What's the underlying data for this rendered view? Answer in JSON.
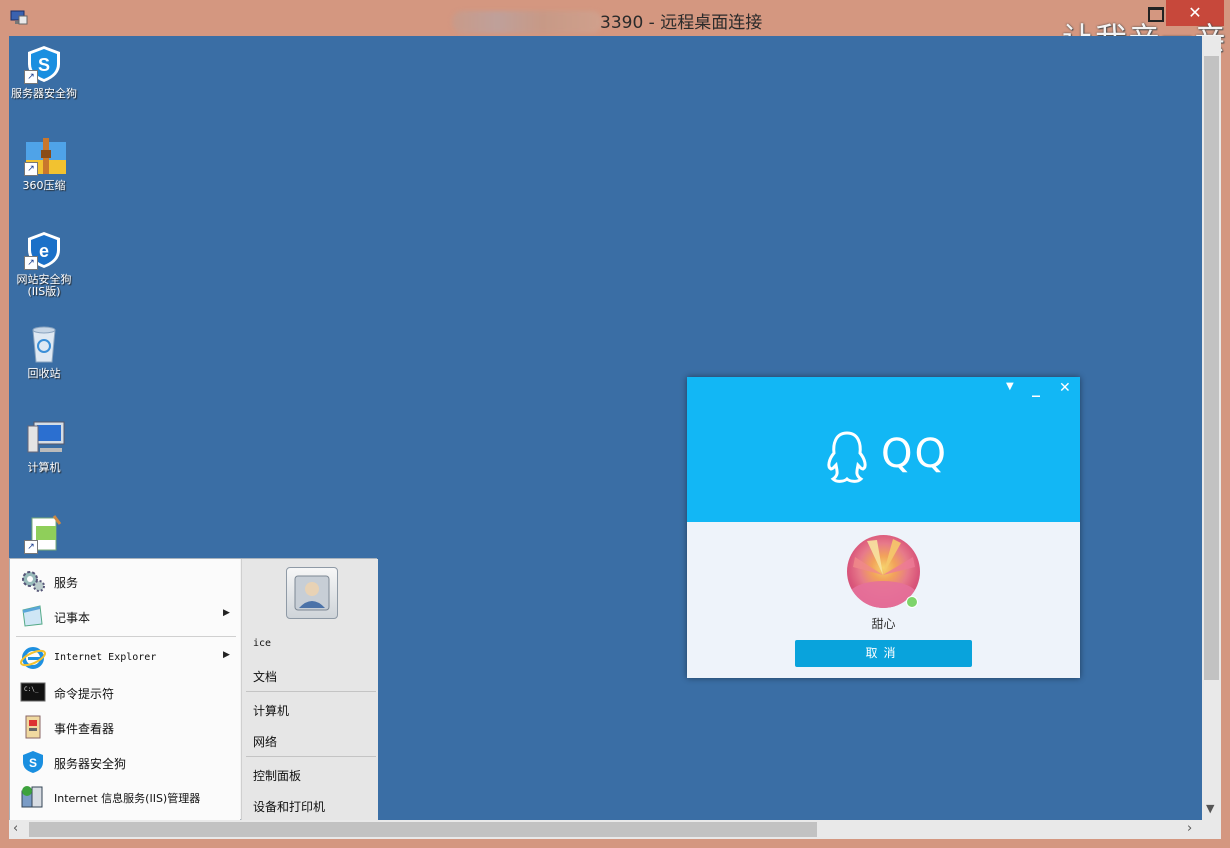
{
  "window": {
    "title": "3390 - 远程桌面连接",
    "close_glyph": "✕",
    "watermark": "让我亲一亲"
  },
  "desktop": {
    "icons": [
      {
        "label": "服务器安全狗",
        "icon": "shield-s-icon"
      },
      {
        "label": "360压缩",
        "icon": "zip-folder-icon"
      },
      {
        "label": "网站安全狗\n(IIS版)",
        "icon": "shield-e-icon"
      },
      {
        "label": "回收站",
        "icon": "recycle-bin-icon"
      },
      {
        "label": "计算机",
        "icon": "computer-icon"
      },
      {
        "label": "",
        "icon": "notepad-app-icon"
      }
    ]
  },
  "qq_dialog": {
    "logo_text": "QQ",
    "user_name": "甜心",
    "cancel_label": "取消",
    "header_color": "#12b7f5",
    "button_color": "#09a3dc"
  },
  "start_menu": {
    "left_items": [
      {
        "label": "服务",
        "icon": "services-gear-icon",
        "submenu": false
      },
      {
        "label": "记事本",
        "icon": "notepad-icon",
        "submenu": true
      },
      {
        "label": "Internet Explorer",
        "icon": "ie-icon",
        "submenu": true
      },
      {
        "label": "命令提示符",
        "icon": "cmd-icon",
        "submenu": false
      },
      {
        "label": "事件查看器",
        "icon": "event-viewer-icon",
        "submenu": false
      },
      {
        "label": "服务器安全狗",
        "icon": "shield-s-icon",
        "submenu": false
      },
      {
        "label": "Internet 信息服务(IIS)管理器",
        "icon": "iis-icon",
        "submenu": false
      }
    ],
    "right_items": [
      {
        "label": "ice"
      },
      {
        "label": "文档"
      },
      {
        "label": "计算机"
      },
      {
        "label": "网络"
      },
      {
        "label": "控制面板"
      },
      {
        "label": "设备和打印机"
      }
    ]
  },
  "colors": {
    "desktop": "#3a6ea5",
    "frame": "#d49780",
    "close": "#c7483b"
  }
}
